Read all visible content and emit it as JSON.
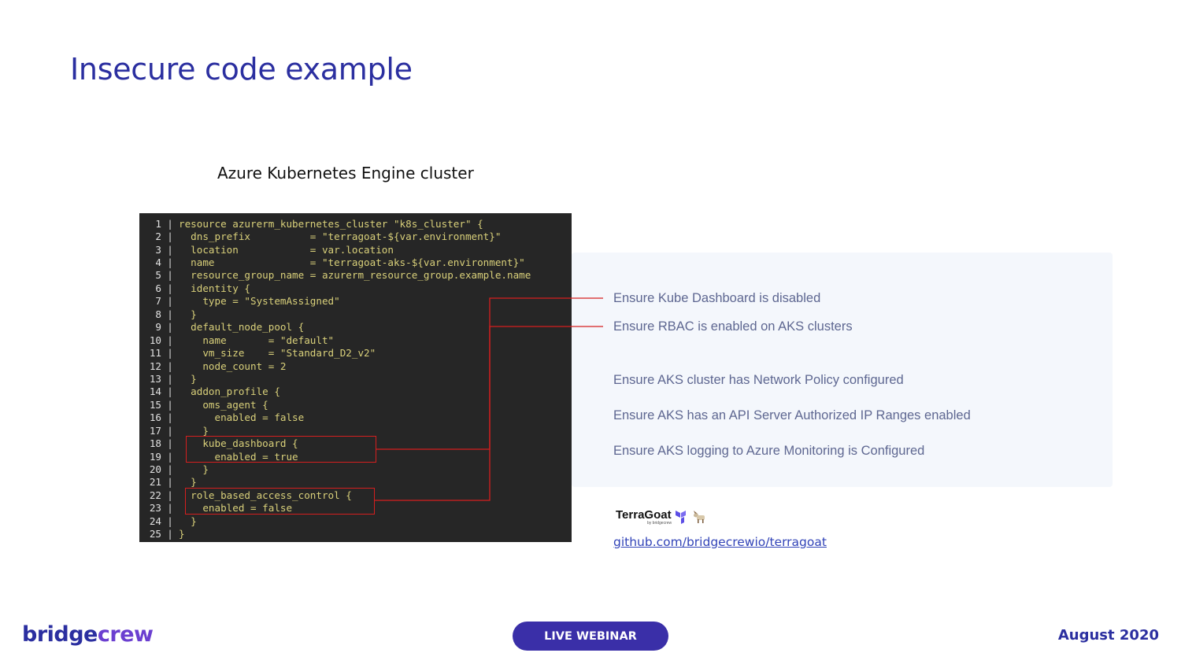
{
  "slide": {
    "title": "Insecure code example",
    "code_caption": "Azure Kubernetes Engine cluster"
  },
  "code": {
    "lines": [
      {
        "num": "1",
        "text": "resource azurerm_kubernetes_cluster \"k8s_cluster\" {"
      },
      {
        "num": "2",
        "text": "  dns_prefix          = \"terragoat-${var.environment}\""
      },
      {
        "num": "3",
        "text": "  location            = var.location"
      },
      {
        "num": "4",
        "text": "  name                = \"terragoat-aks-${var.environment}\""
      },
      {
        "num": "5",
        "text": "  resource_group_name = azurerm_resource_group.example.name"
      },
      {
        "num": "6",
        "text": "  identity {"
      },
      {
        "num": "7",
        "text": "    type = \"SystemAssigned\""
      },
      {
        "num": "8",
        "text": "  }"
      },
      {
        "num": "9",
        "text": "  default_node_pool {"
      },
      {
        "num": "10",
        "text": "    name       = \"default\""
      },
      {
        "num": "11",
        "text": "    vm_size    = \"Standard_D2_v2\""
      },
      {
        "num": "12",
        "text": "    node_count = 2"
      },
      {
        "num": "13",
        "text": "  }"
      },
      {
        "num": "14",
        "text": "  addon_profile {"
      },
      {
        "num": "15",
        "text": "    oms_agent {"
      },
      {
        "num": "16",
        "text": "      enabled = false"
      },
      {
        "num": "17",
        "text": "    }"
      },
      {
        "num": "18",
        "text": "    kube_dashboard {"
      },
      {
        "num": "19",
        "text": "      enabled = true"
      },
      {
        "num": "20",
        "text": "    }"
      },
      {
        "num": "21",
        "text": "  }"
      },
      {
        "num": "22",
        "text": "  role_based_access_control {"
      },
      {
        "num": "23",
        "text": "    enabled = false"
      },
      {
        "num": "24",
        "text": "  }"
      },
      {
        "num": "25",
        "text": "}"
      }
    ]
  },
  "checks": [
    "Ensure Kube Dashboard is disabled",
    "Ensure RBAC is enabled on AKS clusters",
    "Ensure AKS cluster has Network Policy configured",
    "Ensure AKS has an API Server Authorized IP Ranges enabled",
    "Ensure AKS logging to Azure Monitoring is Configured"
  ],
  "terragoat": {
    "logo_text": "TerraGoat",
    "logo_subtext": "by bridgecrew",
    "link": "github.com/bridgecrewio/terragoat"
  },
  "footer": {
    "brand_part1": "bridge",
    "brand_part2": "crew",
    "webinar_label": "LIVE WEBINAR",
    "date": "August 2020"
  },
  "colors": {
    "title": "#2b2fa0",
    "code_bg": "#262626",
    "code_text": "#d9d07a",
    "highlight": "#d51f1f",
    "check_text": "#5e6791",
    "panel_bg": "#f4f7fc",
    "pill_bg": "#3a2fa8"
  },
  "icons": [
    "terraform-icon",
    "goat-icon"
  ]
}
